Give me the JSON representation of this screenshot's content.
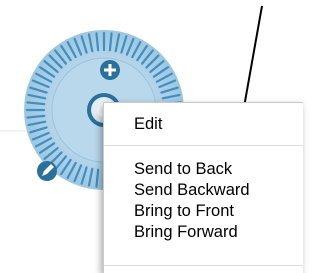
{
  "context_menu": {
    "items": [
      {
        "label": "Edit"
      },
      {
        "separator": true
      },
      {
        "label": "Send to Back"
      },
      {
        "label": "Send Backward"
      },
      {
        "label": "Bring to Front"
      },
      {
        "label": "Bring Forward"
      },
      {
        "separator": true
      }
    ]
  },
  "dial": {
    "icons": [
      "plus-icon",
      "center-knob-icon",
      "pencil-icon"
    ],
    "colors": {
      "ring": "#a9cde3",
      "ticks": "#3f90c2",
      "icon_fill": "#2b6f9b"
    }
  },
  "colors": {
    "menu_bg": "#ffffff",
    "separator": "#dcdcdc",
    "arrow": "#000000"
  }
}
